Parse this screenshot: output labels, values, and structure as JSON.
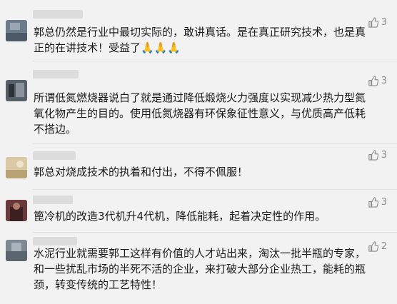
{
  "comments": [
    {
      "text": "郭总仍然是行业中最切实际的，敢讲真话。是在真正研究技术，也是真正的在讲技术！受益了🙏🙏🙏",
      "likes": "3"
    },
    {
      "text": "所谓低氮燃烧器说白了就是通过降低煅烧火力强度以实现减少热力型氮氧化物产生的目的。使用低氮烧器有环保象征性意义，与优质高产低耗不搭边。",
      "likes": "3"
    },
    {
      "text": "郭总对烧成技术的执着和付出，不得不佩服！",
      "likes": "3"
    },
    {
      "text": "篦冷机的改造3代机升4代机，降低能耗，起着决定性的作用。",
      "likes": "3"
    },
    {
      "text": "水泥行业就需要郭工这样有价值的人才站出来，淘汰一批半瓶的专家，和一些扰乱市场的半死不活的企业，来打破大部分企业热工，能耗的瓶颈，转变传统的工艺特性！",
      "likes": "2"
    }
  ],
  "colors": {
    "background": "#f2f2f2",
    "text": "#1a1a1a",
    "like": "#8c8c8c"
  },
  "icons": {
    "like": "thumbs-up-icon"
  }
}
